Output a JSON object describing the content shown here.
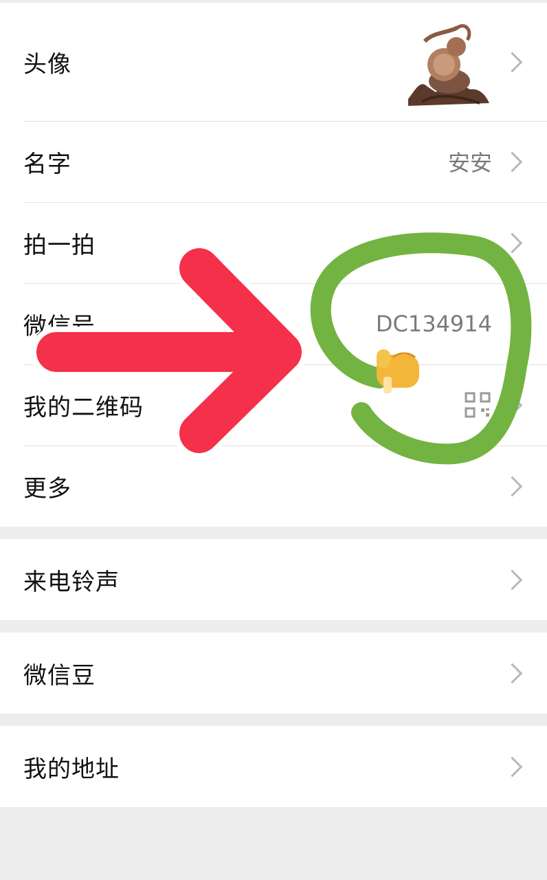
{
  "profile": {
    "avatar_label": "头像",
    "name_label": "名字",
    "name_value": "安安",
    "pat_label": "拍一拍",
    "wechat_id_label": "微信号",
    "wechat_id_value": "DC134914",
    "qr_label": "我的二维码",
    "more_label": "更多"
  },
  "settings": {
    "ringtone_label": "来电铃声",
    "beans_label": "微信豆",
    "address_label": "我的地址"
  },
  "icons": {
    "chevron": "chevron-right-icon",
    "qr": "qr-code-icon",
    "avatar": "avatar-image",
    "arrow": "red-arrow-icon",
    "circle": "green-circle-annotation",
    "thumb": "thumbs-up-emoji"
  },
  "colors": {
    "arrow_red": "#f4304a",
    "circle_green": "#73b341",
    "background": "#ededed"
  }
}
